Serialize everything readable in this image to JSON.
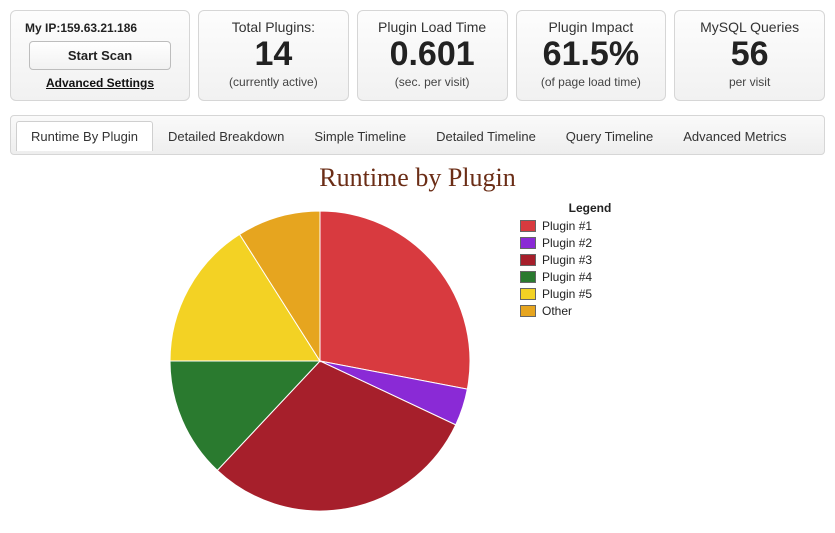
{
  "control": {
    "ip_label": "My IP:159.63.21.186",
    "start_scan": "Start Scan",
    "advanced_settings": "Advanced Settings"
  },
  "stats": [
    {
      "title": "Total Plugins:",
      "value": "14",
      "sub": "(currently active)"
    },
    {
      "title": "Plugin Load Time",
      "value": "0.601",
      "sub": "(sec. per visit)"
    },
    {
      "title": "Plugin Impact",
      "value": "61.5%",
      "sub": "(of page load time)"
    },
    {
      "title": "MySQL Queries",
      "value": "56",
      "sub": "per visit"
    }
  ],
  "tabs": [
    {
      "label": "Runtime By Plugin",
      "active": true
    },
    {
      "label": "Detailed Breakdown",
      "active": false
    },
    {
      "label": "Simple Timeline",
      "active": false
    },
    {
      "label": "Detailed Timeline",
      "active": false
    },
    {
      "label": "Query Timeline",
      "active": false
    },
    {
      "label": "Advanced Metrics",
      "active": false
    }
  ],
  "chart_title": "Runtime by Plugin",
  "legend_title": "Legend",
  "chart_data": {
    "type": "pie",
    "title": "Runtime by Plugin",
    "series": [
      {
        "name": "Plugin #1",
        "value": 28,
        "color": "#d83a3f"
      },
      {
        "name": "Plugin #2",
        "value": 4,
        "color": "#8a2ad6"
      },
      {
        "name": "Plugin #3",
        "value": 30,
        "color": "#a61f2b"
      },
      {
        "name": "Plugin #4",
        "value": 13,
        "color": "#2a7a2f"
      },
      {
        "name": "Plugin #5",
        "value": 16,
        "color": "#f3d224"
      },
      {
        "name": "Other",
        "value": 9,
        "color": "#e6a51f"
      }
    ]
  }
}
